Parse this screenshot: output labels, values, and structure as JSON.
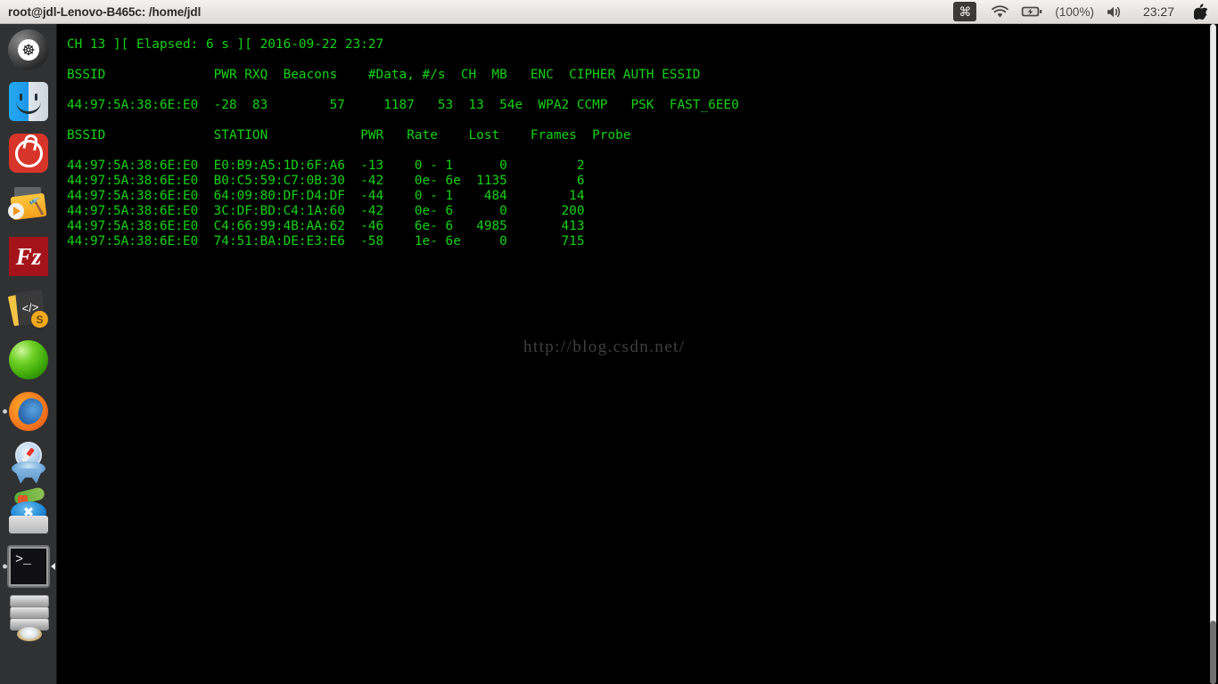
{
  "window": {
    "title": "root@jdl-Lenovo-B465c: /home/jdl"
  },
  "tray": {
    "keyboard_indicator": "⌘",
    "wifi_icon": "wifi-icon",
    "battery_icon": "battery-charging-icon",
    "battery_label": "(100%)",
    "volume_icon": "speaker-icon",
    "clock": "23:27",
    "apple_logo": ""
  },
  "launcher": {
    "items": [
      {
        "name": "ubuntu-dash",
        "label": "Ubuntu Dash",
        "running": false,
        "focused": false
      },
      {
        "name": "finder",
        "label": "Finder",
        "running": false,
        "focused": false
      },
      {
        "name": "netease-music",
        "label": "NetEase Cloud Music",
        "running": false,
        "focused": false
      },
      {
        "name": "project-folder",
        "label": "Media Folder",
        "running": false,
        "focused": false
      },
      {
        "name": "filezilla",
        "label": "FileZilla",
        "running": false,
        "focused": false
      },
      {
        "name": "sublime-text",
        "label": "Sublime Text",
        "running": false,
        "focused": false
      },
      {
        "name": "green-orb",
        "label": "Green Orb App",
        "running": false,
        "focused": false
      },
      {
        "name": "firefox",
        "label": "Firefox Web Browser",
        "running": true,
        "focused": false
      },
      {
        "name": "safari-shapes",
        "label": "Safari",
        "running": false,
        "focused": false
      },
      {
        "name": "app-store",
        "label": "App Store",
        "running": false,
        "focused": false
      },
      {
        "name": "terminal",
        "label": "Terminal",
        "running": true,
        "focused": true
      },
      {
        "name": "disk-drives",
        "label": "Disk Utility",
        "running": false,
        "focused": false
      }
    ]
  },
  "terminal": {
    "status_line": "CH 13 ][ Elapsed: 6 s ][ 2016-09-22 23:27",
    "ap_header": "BSSID              PWR RXQ  Beacons    #Data, #/s  CH  MB   ENC  CIPHER AUTH ESSID",
    "ap_row": "44:97:5A:38:6E:E0  -28  83        57     1187   53  13  54e  WPA2 CCMP   PSK  FAST_6EE0",
    "station_header": "BSSID              STATION            PWR   Rate    Lost    Frames  Probe",
    "station_rows": "44:97:5A:38:6E:E0  E0:B9:A5:1D:6F:A6  -13    0 - 1      0         2\n44:97:5A:38:6E:E0  B0:C5:59:C7:0B:30  -42    0e- 6e  1135         6\n44:97:5A:38:6E:E0  64:09:80:DF:D4:DF  -44    0 - 1    484        14\n44:97:5A:38:6E:E0  3C:DF:BD:C4:1A:60  -42    0e- 6      0       200\n44:97:5A:38:6E:E0  C4:66:99:4B:AA:62  -46    6e- 6   4985       413\n44:97:5A:38:6E:E0  74:51:BA:DE:E3:E6  -58    1e- 6e     0       715",
    "watermark": "http://blog.csdn.net/",
    "colors": {
      "background": "#000000",
      "foreground": "#15d315",
      "watermark": "#3f3f3f"
    },
    "airodump_table": {
      "access_points": [
        {
          "bssid": "44:97:5A:38:6E:E0",
          "pwr": "-28",
          "rxq": "83",
          "beacons": "57",
          "data": "1187",
          "per_sec": "53",
          "ch": "13",
          "mb": "54e",
          "enc": "WPA2",
          "cipher": "CCMP",
          "auth": "PSK",
          "essid": "FAST_6EE0"
        }
      ],
      "stations": [
        {
          "bssid": "44:97:5A:38:6E:E0",
          "station": "E0:B9:A5:1D:6F:A6",
          "pwr": "-13",
          "rate": "0 - 1",
          "lost": "0",
          "frames": "2",
          "probe": ""
        },
        {
          "bssid": "44:97:5A:38:6E:E0",
          "station": "B0:C5:59:C7:0B:30",
          "pwr": "-42",
          "rate": "0e- 6e",
          "lost": "1135",
          "frames": "6",
          "probe": ""
        },
        {
          "bssid": "44:97:5A:38:6E:E0",
          "station": "64:09:80:DF:D4:DF",
          "pwr": "-44",
          "rate": "0 - 1",
          "lost": "484",
          "frames": "14",
          "probe": ""
        },
        {
          "bssid": "44:97:5A:38:6E:E0",
          "station": "3C:DF:BD:C4:1A:60",
          "pwr": "-42",
          "rate": "0e- 6",
          "lost": "0",
          "frames": "200",
          "probe": ""
        },
        {
          "bssid": "44:97:5A:38:6E:E0",
          "station": "C4:66:99:4B:AA:62",
          "pwr": "-46",
          "rate": "6e- 6",
          "lost": "4985",
          "frames": "413",
          "probe": ""
        },
        {
          "bssid": "44:97:5A:38:6E:E0",
          "station": "74:51:BA:DE:E3:E6",
          "pwr": "-58",
          "rate": "1e- 6e",
          "lost": "0",
          "frames": "715",
          "probe": ""
        }
      ]
    }
  },
  "scrollbar": {
    "thumb_position": "bottom"
  }
}
